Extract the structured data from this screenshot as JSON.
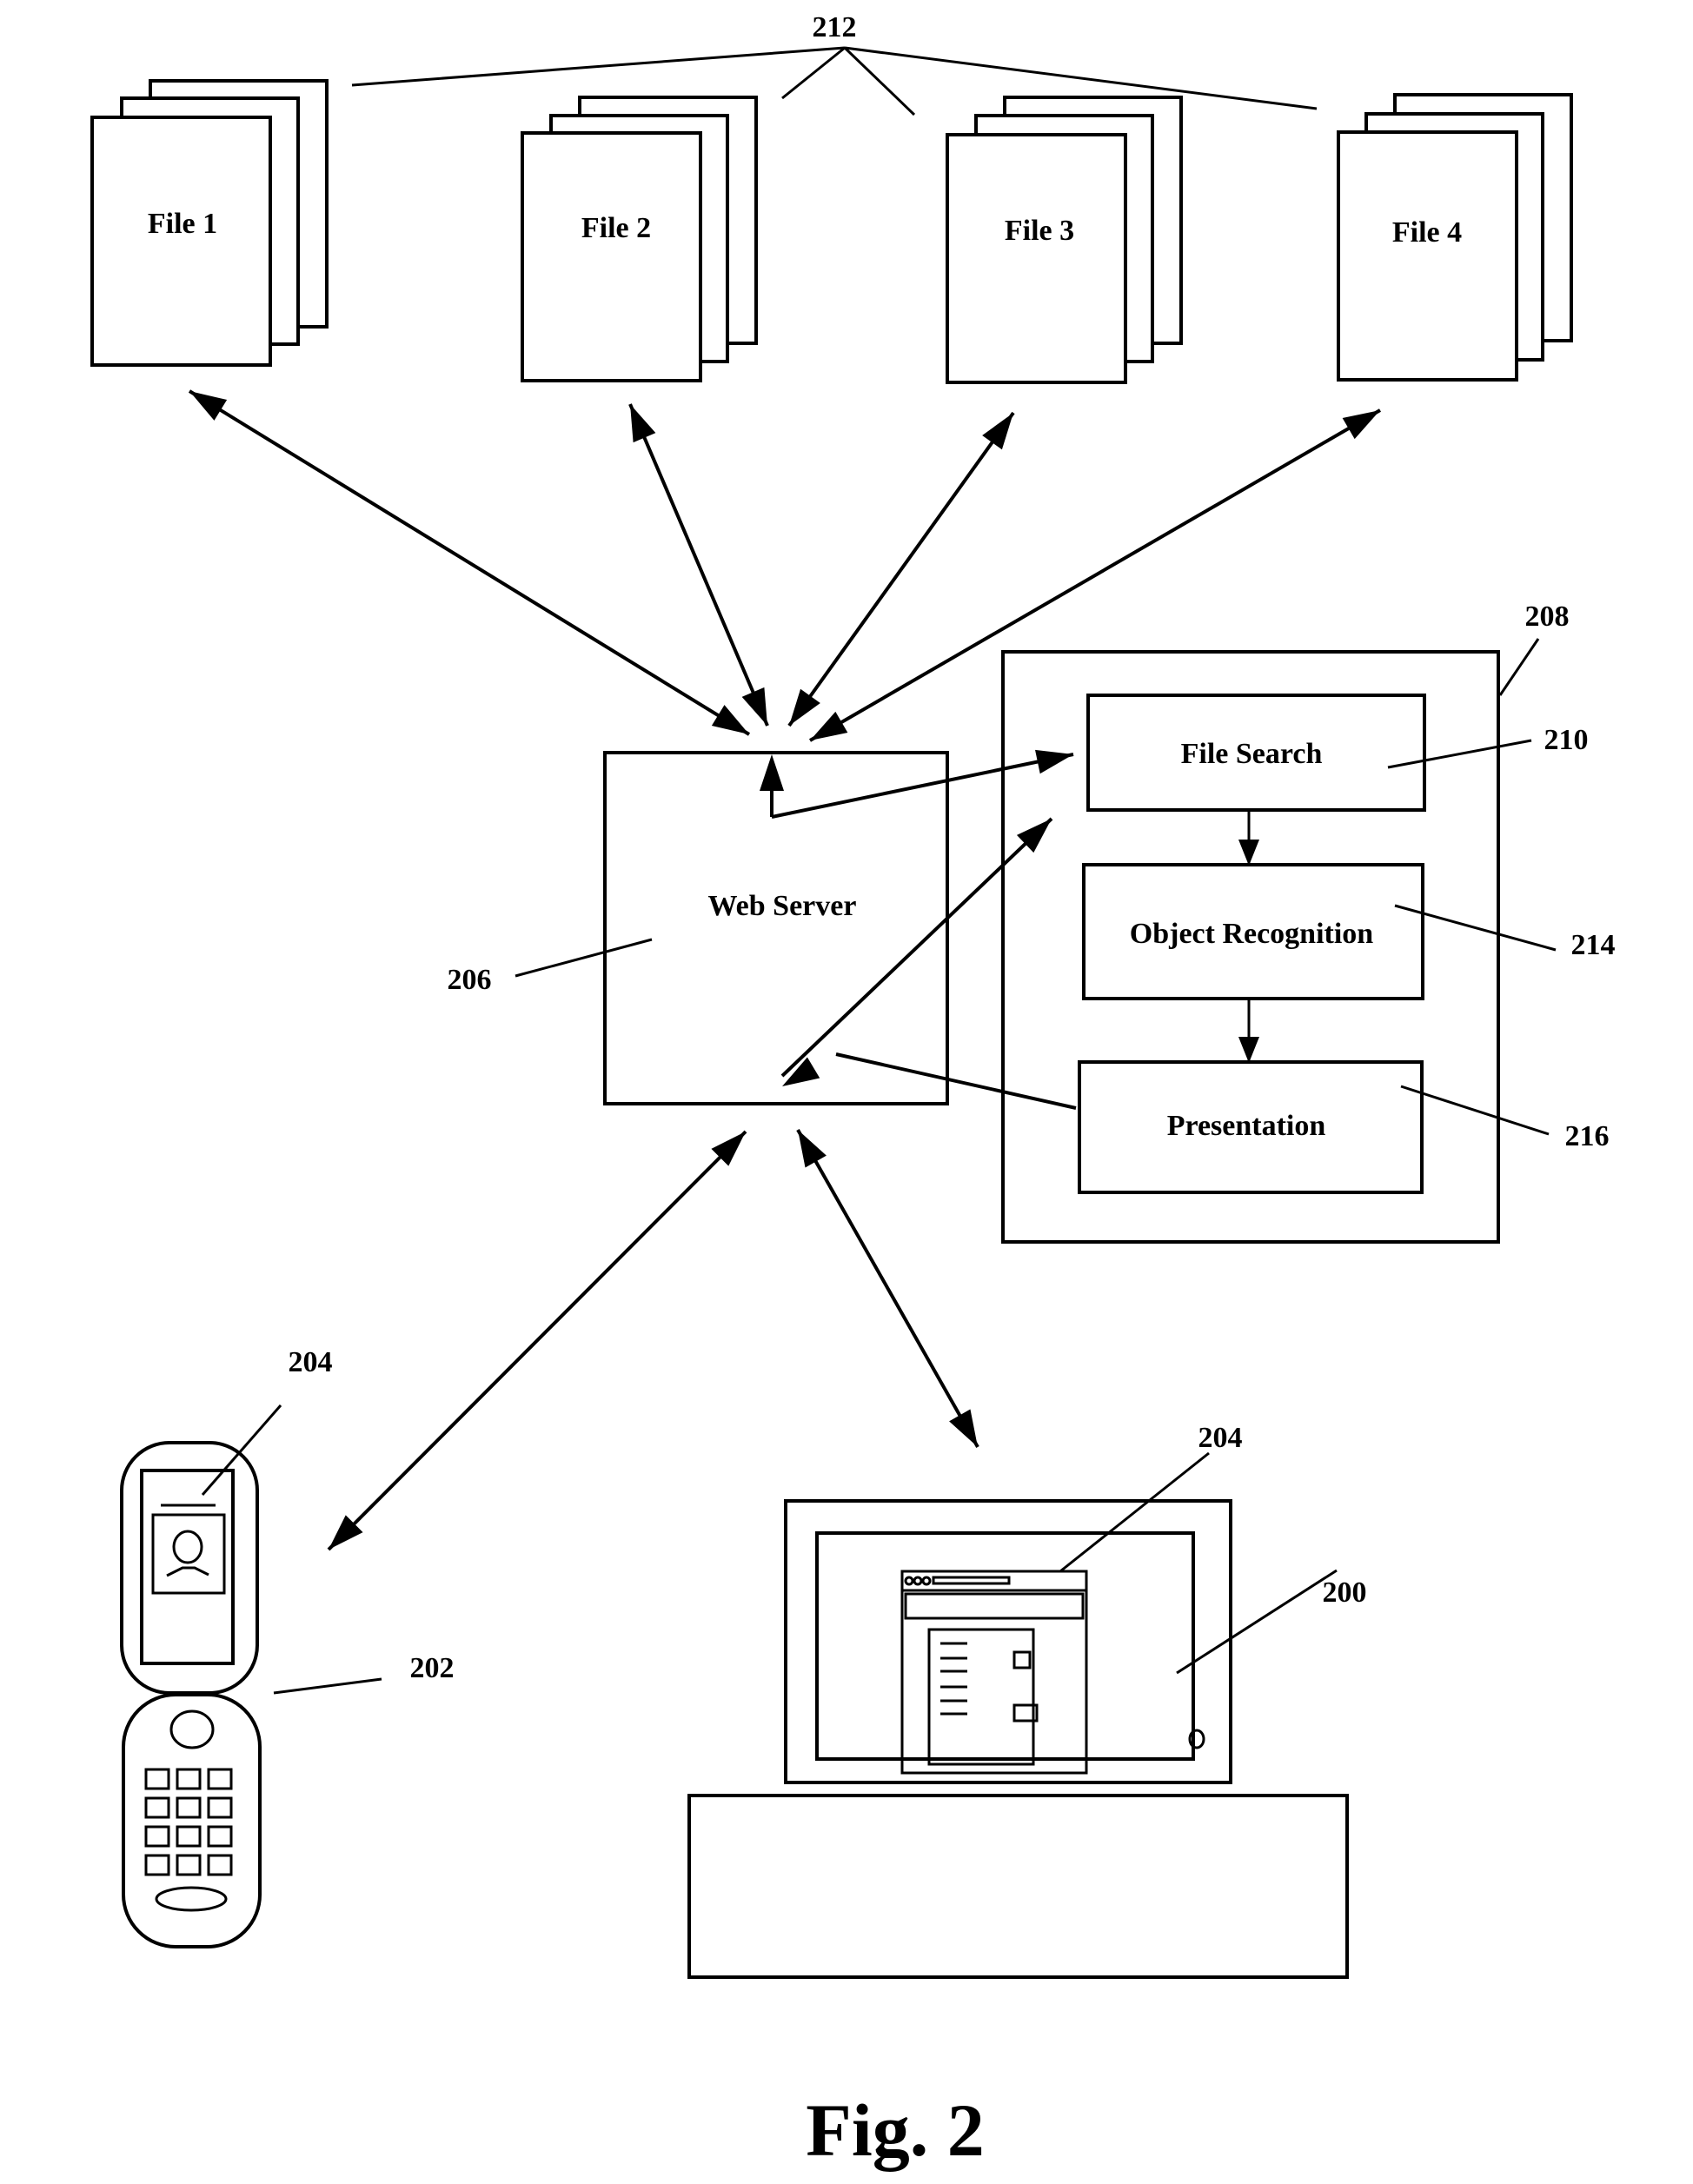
{
  "figure": {
    "caption": "Fig. 2",
    "files_ref": "212",
    "files": [
      {
        "label": "File 1"
      },
      {
        "label": "File 2"
      },
      {
        "label": "File 3"
      },
      {
        "label": "File 4"
      }
    ],
    "web_server": {
      "label": "Web Server",
      "ref": "206"
    },
    "processing_system": {
      "ref": "208",
      "modules": [
        {
          "label": "File Search",
          "ref": "210"
        },
        {
          "label": "Object Recognition",
          "ref": "214"
        },
        {
          "label": "Presentation",
          "ref": "216"
        }
      ]
    },
    "mobile_device": {
      "ref": "202",
      "display_ref": "204"
    },
    "computer": {
      "ref": "200",
      "display_ref": "204"
    }
  }
}
